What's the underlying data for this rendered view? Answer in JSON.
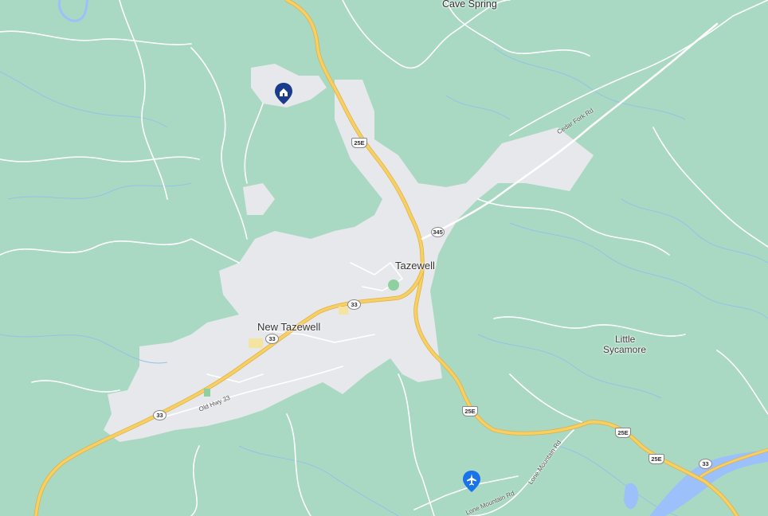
{
  "map": {
    "colors": {
      "forest": "#a8d8c2",
      "urban": "#e8e9ec",
      "highway": "#f6cf65",
      "highway_outline": "#e0b040",
      "minor_road": "#ffffff",
      "water": "#9cc0f9",
      "pin_blue": "#1a3c8c",
      "airport_blue": "#1a73e8"
    },
    "places": {
      "cave_spring": "Cave Spring",
      "tazewell": "Tazewell",
      "new_tazewell": "New Tazewell",
      "little_sycamore_1": "Little",
      "little_sycamore_2": "Sycamore"
    },
    "roads": {
      "cedar_fork": "Cedar Fork Rd",
      "old_hwy_33": "Old Hwy 33",
      "lone_mountain_1": "Lone Mountain Rd",
      "lone_mountain_2": "Lone Mountain Rd"
    },
    "shields": {
      "us25e_north": "25E",
      "sr345": "345",
      "sr33_east": "33",
      "sr33_mid": "33",
      "sr33_west": "33",
      "us25e_south": "25E",
      "us25e_east1": "25E",
      "us25e_east2": "25E",
      "sr33_far_east": "33"
    },
    "pins": {
      "home": "home-pin-icon",
      "airport": "airport-pin-icon"
    }
  }
}
